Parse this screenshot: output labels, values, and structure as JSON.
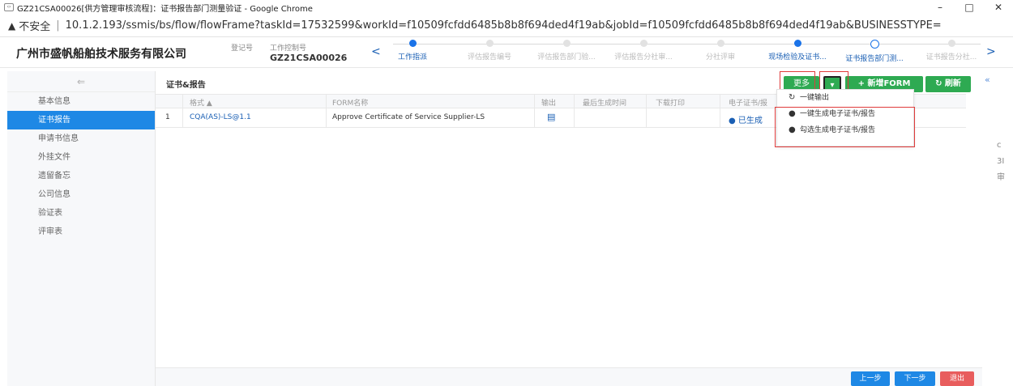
{
  "browser": {
    "tab_icon": "‹›",
    "title": "GZ21CSA00026[供方管理审核流程]：证书报告部门测量验证 - Google Chrome",
    "insecure_label": "不安全",
    "url": "10.1.2.193/ssmis/bs/flow/flowFrame?taskId=17532599&workId=f10509fcfdd6485b8b8f694ded4f19ab&jobId=f10509fcfdd6485b8b8f694ded4f19ab&BUSINESSTYPE=undefined&URL=u...",
    "minimize": "–",
    "maximize": "□",
    "close": "✕"
  },
  "header": {
    "company": "广州市盛帆船舶技术服务有限公司",
    "reg_label": "登记号",
    "work_control_label": "工作控制号",
    "work_control_value": "GZ21CSA00026",
    "prev_arrow": "<",
    "next_arrow": ">",
    "steps": [
      {
        "label": "工作指派",
        "state": "done"
      },
      {
        "label": "评估报告编号",
        "state": "pending"
      },
      {
        "label": "评估报告部门验...",
        "state": "pending"
      },
      {
        "label": "评估报告分社审...",
        "state": "pending"
      },
      {
        "label": "分社评审",
        "state": "pending"
      },
      {
        "label": "现场检验及证书...",
        "state": "done"
      },
      {
        "label": "证书报告部门测...",
        "state": "current"
      },
      {
        "label": "证书报告分社...",
        "state": "pending"
      }
    ]
  },
  "sidebar": {
    "head_icon": "⇐",
    "items": [
      {
        "label": "基本信息",
        "active": false
      },
      {
        "label": "证书报告",
        "active": true
      },
      {
        "label": "申请书信息",
        "active": false
      },
      {
        "label": "外挂文件",
        "active": false
      },
      {
        "label": "遗留备忘",
        "active": false
      },
      {
        "label": "公司信息",
        "active": false
      },
      {
        "label": "验证表",
        "active": false
      },
      {
        "label": "评审表",
        "active": false
      }
    ]
  },
  "main": {
    "title": "证书&报告",
    "buttons": {
      "more": "更多",
      "caret": "▾",
      "new_form": "+ 新增FORM",
      "refresh": "↻ 刷新"
    },
    "columns": {
      "format": "格式 ▲",
      "form_name": "FORM名称",
      "output": "输出",
      "last_gen_time": "最后生成时间",
      "download_print": "下载打印",
      "e_cert": "电子证书/报"
    },
    "rows": [
      {
        "index": "1",
        "format": "CQA(AS)-LS@1.1",
        "form_name": "Approve Certificate of Service Supplier-LS",
        "output_icon": "▤",
        "last_gen_time": "",
        "download_print": "",
        "e_cert": "● 已生成"
      }
    ],
    "menu": {
      "items": [
        {
          "icon": "↻",
          "label": "一键输出"
        },
        {
          "icon": "●",
          "label": "一键生成电子证书/报告"
        },
        {
          "icon": "●",
          "label": "勾选生成电子证书/报告"
        }
      ]
    },
    "footer": {
      "prev": "上一步",
      "next": "下一步",
      "exit": "退出"
    }
  },
  "collapse_icon": "«",
  "right_edge_text": "c\n3I\n审"
}
